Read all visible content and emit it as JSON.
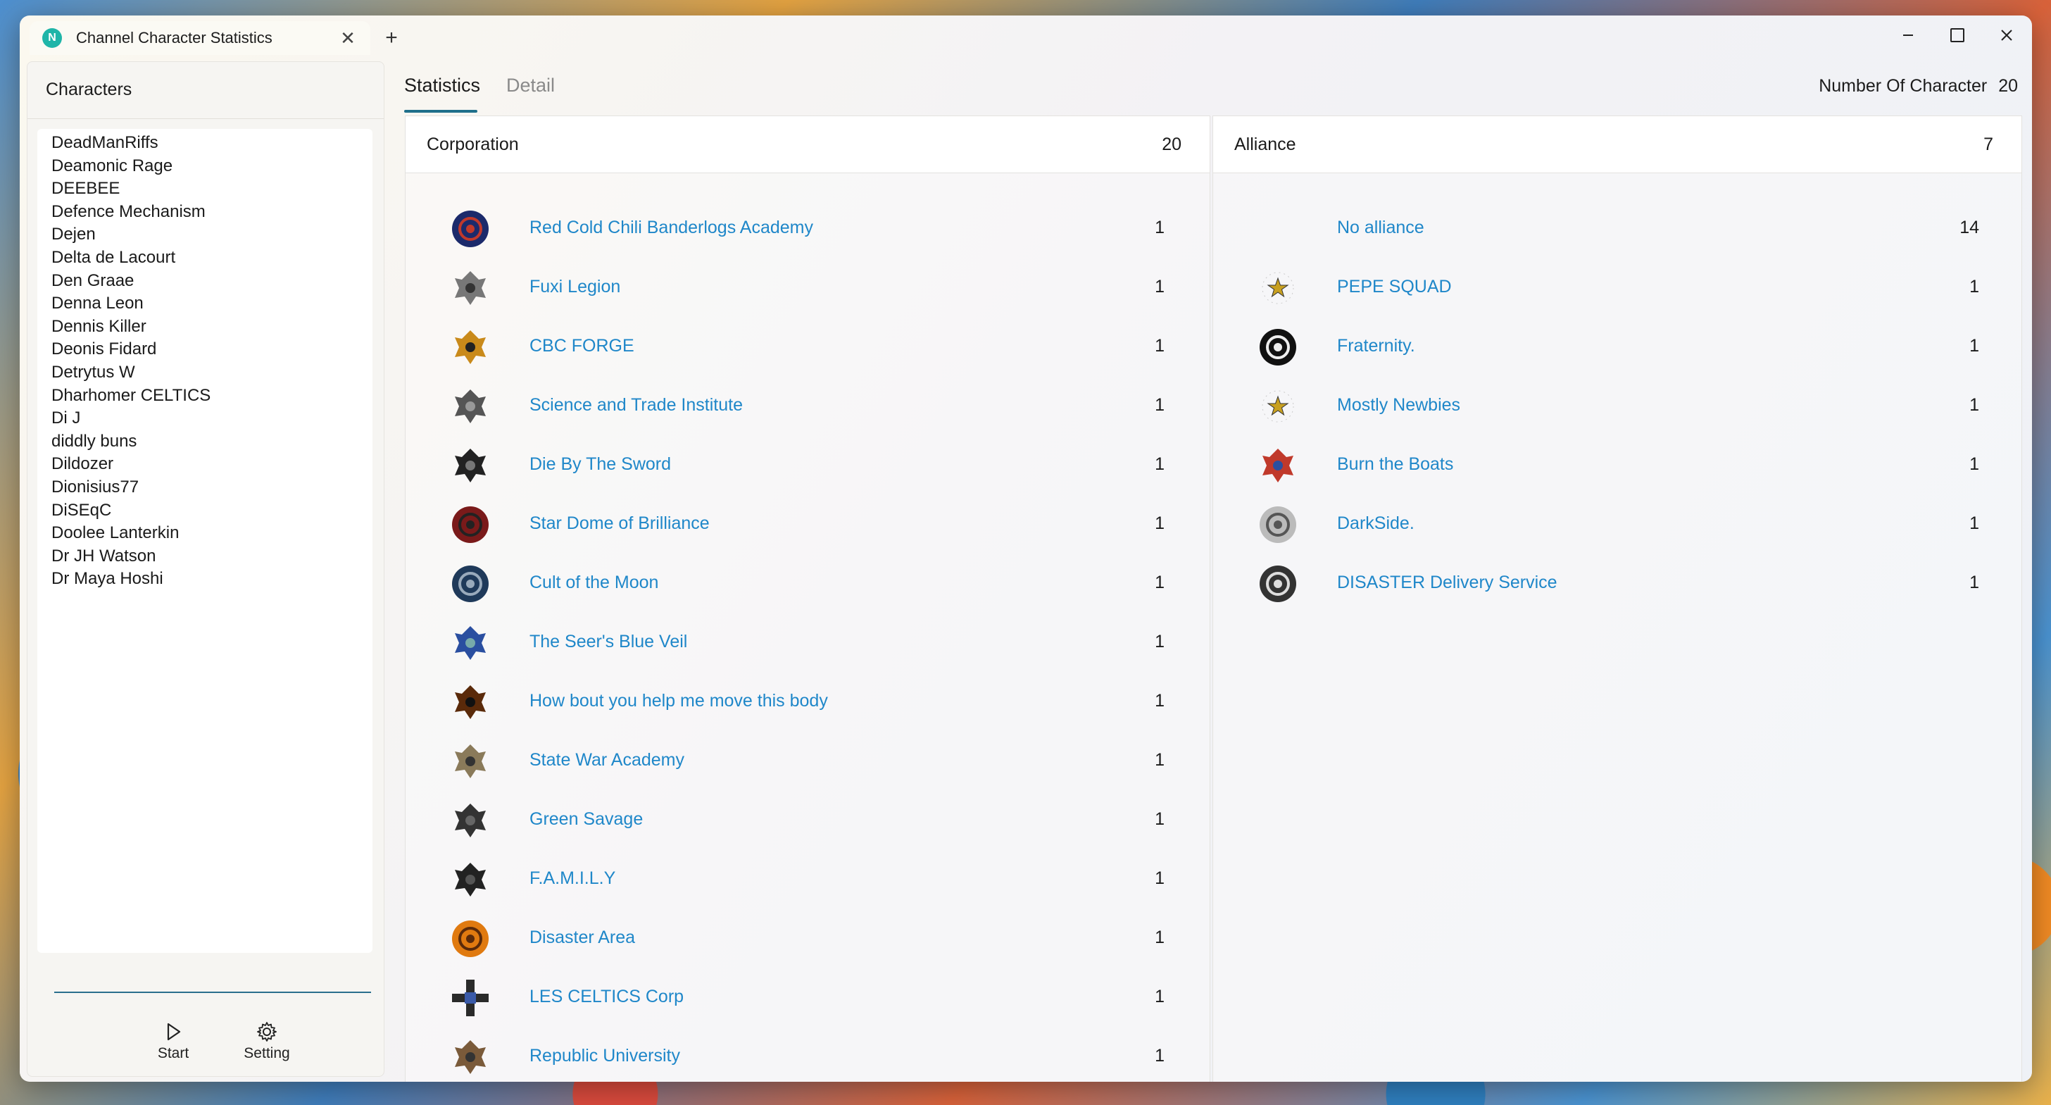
{
  "window": {
    "tab_title": "Channel Character Statistics",
    "app_icon_letter": "N",
    "new_tab": "+",
    "close_tab": "✕"
  },
  "sidebar": {
    "header": "Characters",
    "characters": [
      "DeadManRiffs",
      "Deamonic Rage",
      "DEEBEE",
      "Defence Mechanism",
      "Dejen",
      "Delta de Lacourt",
      "Den Graae",
      "Denna Leon",
      "Dennis Killer",
      "Deonis Fidard",
      "Detrytus W",
      "Dharhomer CELTICS",
      "Di J",
      "diddly buns",
      "Dildozer",
      "Dionisius77",
      "DiSEqC",
      "Doolee Lanterkin",
      "Dr JH Watson",
      "Dr Maya Hoshi"
    ],
    "start_label": "Start",
    "setting_label": "Setting"
  },
  "main": {
    "tabs": [
      "Statistics",
      "Detail"
    ],
    "count_label": "Number Of Character",
    "count_value": "20"
  },
  "corporation": {
    "title": "Corporation",
    "count": "20",
    "rows": [
      {
        "name": "Red Cold Chili Banderlogs Academy",
        "count": "1",
        "icon": "corp-logo-blue-circle-icon"
      },
      {
        "name": "Fuxi Legion",
        "count": "1",
        "icon": "corp-logo-dragon-icon"
      },
      {
        "name": "CBC FORGE",
        "count": "1",
        "icon": "corp-logo-forge-icon"
      },
      {
        "name": "Science and Trade Institute",
        "count": "1",
        "icon": "corp-logo-sti-icon"
      },
      {
        "name": "Die By The Sword",
        "count": "1",
        "icon": "corp-logo-eagle-icon"
      },
      {
        "name": "Star Dome of Brilliance",
        "count": "1",
        "icon": "corp-logo-star-dome-icon"
      },
      {
        "name": "Cult of the Moon",
        "count": "1",
        "icon": "corp-logo-moon-icon"
      },
      {
        "name": "The Seer's Blue Veil",
        "count": "1",
        "icon": "corp-logo-blue-bird-icon"
      },
      {
        "name": "How bout you help me move this body",
        "count": "1",
        "icon": "corp-logo-dark-icon"
      },
      {
        "name": "State War Academy",
        "count": "1",
        "icon": "corp-logo-swa-icon"
      },
      {
        "name": "Green Savage",
        "count": "1",
        "icon": "corp-logo-black-eagle-icon"
      },
      {
        "name": "F.A.M.I.L.Y",
        "count": "1",
        "icon": "corp-logo-family-icon"
      },
      {
        "name": "Disaster Area",
        "count": "1",
        "icon": "corp-logo-orange-circle-icon"
      },
      {
        "name": "LES CELTICS Corp",
        "count": "1",
        "icon": "corp-logo-cross-icon"
      },
      {
        "name": "Republic University",
        "count": "1",
        "icon": "corp-logo-republic-icon"
      }
    ]
  },
  "alliance": {
    "title": "Alliance",
    "count": "7",
    "rows": [
      {
        "name": "No alliance",
        "count": "14",
        "icon": ""
      },
      {
        "name": "PEPE SQUAD",
        "count": "1",
        "icon": "alliance-logo-star-icon"
      },
      {
        "name": "Fraternity.",
        "count": "1",
        "icon": "alliance-logo-skull-icon"
      },
      {
        "name": "Mostly Newbies",
        "count": "1",
        "icon": "alliance-logo-star-icon"
      },
      {
        "name": "Burn the Boats",
        "count": "1",
        "icon": "alliance-logo-fist-icon"
      },
      {
        "name": "DarkSide.",
        "count": "1",
        "icon": "alliance-logo-darkside-icon"
      },
      {
        "name": "DISASTER Delivery Service",
        "count": "1",
        "icon": "alliance-logo-disaster-icon"
      }
    ]
  },
  "colors": {
    "accent": "#1f6f8b",
    "link": "#1f87c9"
  }
}
